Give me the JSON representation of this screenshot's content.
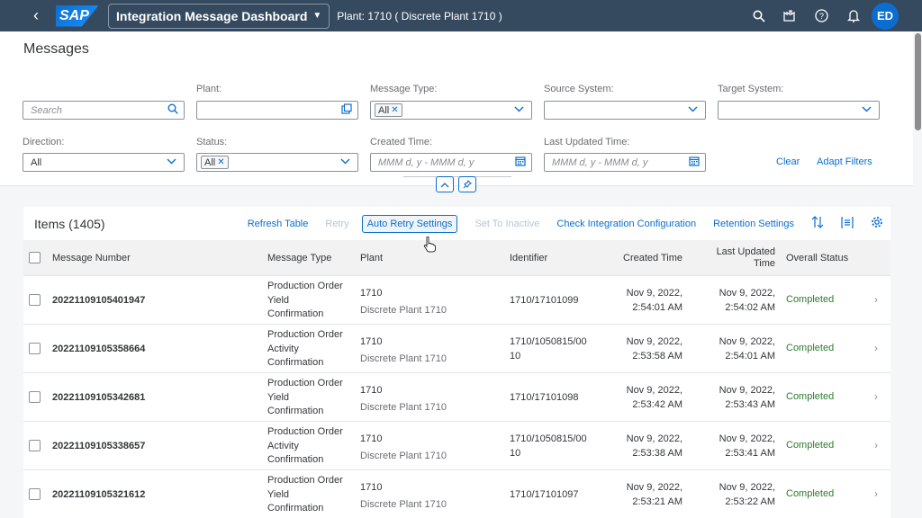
{
  "shell": {
    "back_icon": "back-arrow-icon",
    "logo_text": "SAP",
    "app_title": "Integration Message Dashboard",
    "plant_context": "Plant: 1710 ( Discrete Plant 1710 )",
    "user_initials": "ED"
  },
  "page": {
    "title": "Messages"
  },
  "filters": {
    "search_placeholder": "Search",
    "plant_label": "Plant:",
    "message_type_label": "Message Type:",
    "message_type_token": "All",
    "source_system_label": "Source System:",
    "target_system_label": "Target System:",
    "direction_label": "Direction:",
    "direction_value": "All",
    "status_label": "Status:",
    "status_token": "All",
    "created_time_label": "Created Time:",
    "created_time_placeholder": "MMM d, y - MMM d, y",
    "last_updated_label": "Last Updated Time:",
    "last_updated_placeholder": "MMM d, y - MMM d, y",
    "clear": "Clear",
    "adapt_filters": "Adapt Filters"
  },
  "table": {
    "title": "Items (1405)",
    "actions": {
      "refresh": "Refresh Table",
      "retry": "Retry",
      "auto_retry": "Auto Retry Settings",
      "set_inactive": "Set To Inactive",
      "check_config": "Check Integration Configuration",
      "retention": "Retention Settings"
    },
    "columns": {
      "message_number": "Message Number",
      "message_type": "Message Type",
      "plant": "Plant",
      "identifier": "Identifier",
      "created_time": "Created Time",
      "last_updated_1": "Last Updated",
      "last_updated_2": "Time",
      "overall_status": "Overall Status"
    },
    "rows": [
      {
        "number": "20221109105401947",
        "type1": "Production Order",
        "type2": "Yield",
        "type3": "Confirmation",
        "plant": "1710",
        "plant_name": "Discrete Plant 1710",
        "id1": "1710/17101099",
        "id2": "",
        "created1": "Nov 9, 2022,",
        "created2": "2:54:01 AM",
        "updated1": "Nov 9, 2022,",
        "updated2": "2:54:02 AM",
        "status": "Completed"
      },
      {
        "number": "20221109105358664",
        "type1": "Production Order",
        "type2": "Activity",
        "type3": "Confirmation",
        "plant": "1710",
        "plant_name": "Discrete Plant 1710",
        "id1": "1710/1050815/00",
        "id2": "10",
        "created1": "Nov 9, 2022,",
        "created2": "2:53:58 AM",
        "updated1": "Nov 9, 2022,",
        "updated2": "2:54:01 AM",
        "status": "Completed"
      },
      {
        "number": "20221109105342681",
        "type1": "Production Order",
        "type2": "Yield",
        "type3": "Confirmation",
        "plant": "1710",
        "plant_name": "Discrete Plant 1710",
        "id1": "1710/17101098",
        "id2": "",
        "created1": "Nov 9, 2022,",
        "created2": "2:53:42 AM",
        "updated1": "Nov 9, 2022,",
        "updated2": "2:53:43 AM",
        "status": "Completed"
      },
      {
        "number": "20221109105338657",
        "type1": "Production Order",
        "type2": "Activity",
        "type3": "Confirmation",
        "plant": "1710",
        "plant_name": "Discrete Plant 1710",
        "id1": "1710/1050815/00",
        "id2": "10",
        "created1": "Nov 9, 2022,",
        "created2": "2:53:38 AM",
        "updated1": "Nov 9, 2022,",
        "updated2": "2:53:41 AM",
        "status": "Completed"
      },
      {
        "number": "20221109105321612",
        "type1": "Production Order",
        "type2": "Yield",
        "type3": "Confirmation",
        "plant": "1710",
        "plant_name": "Discrete Plant 1710",
        "id1": "1710/17101097",
        "id2": "",
        "created1": "Nov 9, 2022,",
        "created2": "2:53:21 AM",
        "updated1": "Nov 9, 2022,",
        "updated2": "2:53:22 AM",
        "status": "Completed"
      }
    ]
  },
  "colors": {
    "shell": "#354a5f",
    "accent": "#0a6ed1",
    "success": "#2b7d2b"
  }
}
